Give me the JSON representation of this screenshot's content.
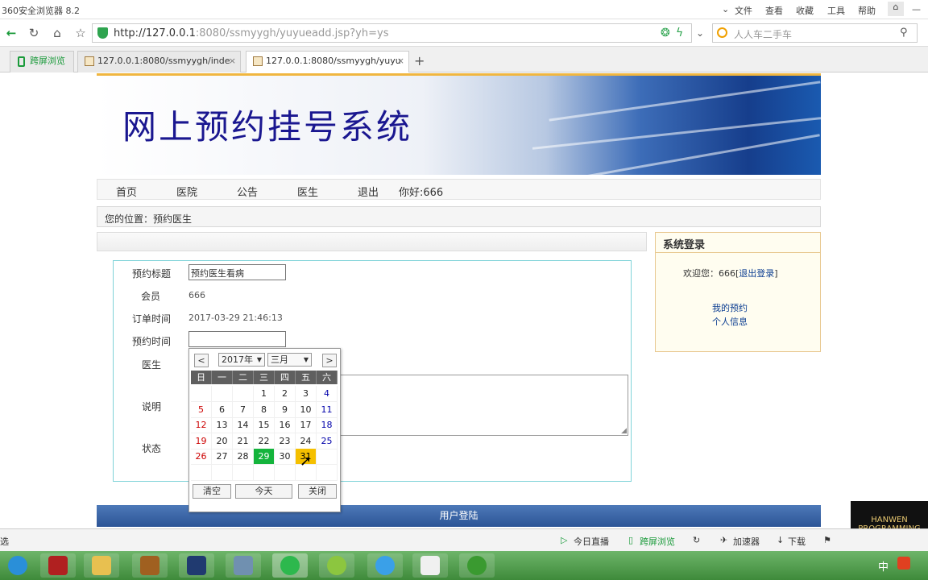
{
  "browser": {
    "app_title": "360安全浏览器 8.2",
    "menu": [
      "文件",
      "查看",
      "收藏",
      "工具",
      "帮助"
    ],
    "url_host": "http://127.0.0.1",
    "url_rest": ":8080/ssmyygh/yuyueadd.jsp?yh=ys",
    "search_text": "人人车二手车",
    "tabs": [
      "跨屏浏览",
      "127.0.0.1:8080/ssmyygh/inde",
      "127.0.0.1:8080/ssmyygh/yuyu"
    ]
  },
  "site": {
    "title": "网上预约挂号系统",
    "nav": [
      "首页",
      "医院",
      "公告",
      "医生",
      "退出",
      "你好:666"
    ],
    "breadcrumb": "您的位置：预约医生"
  },
  "form": {
    "labels": [
      "预约标题",
      "会员",
      "订单时间",
      "预约时间",
      "医生",
      "说明",
      "状态"
    ],
    "title_value": "预约医生看病",
    "member_value": "666",
    "order_time_value": "2017-03-29 21:46:13",
    "reserve_time_value": ""
  },
  "calendar": {
    "prev": "<",
    "next": ">",
    "year": "2017年",
    "month": "三月",
    "weekdays": [
      "日",
      "一",
      "二",
      "三",
      "四",
      "五",
      "六"
    ],
    "weeks": [
      [
        "",
        "",
        "",
        "1",
        "2",
        "3",
        "4"
      ],
      [
        "5",
        "6",
        "7",
        "8",
        "9",
        "10",
        "11"
      ],
      [
        "12",
        "13",
        "14",
        "15",
        "16",
        "17",
        "18"
      ],
      [
        "19",
        "20",
        "21",
        "22",
        "23",
        "24",
        "25"
      ],
      [
        "26",
        "27",
        "28",
        "29",
        "30",
        "31",
        ""
      ],
      [
        "",
        "",
        "",
        "",
        "",
        "",
        ""
      ]
    ],
    "today": "29",
    "hover": "31",
    "clear": "清空",
    "today_btn": "今天",
    "close": "关闭"
  },
  "sidebar": {
    "heading": "系统登录",
    "welcome": "欢迎您：666",
    "logout": "退出登录",
    "links": [
      "我的预约",
      "个人信息"
    ]
  },
  "footer_bar": "用户登陆",
  "statusbar": {
    "left": "选",
    "items": [
      "今日直播",
      "跨屏浏览",
      "加速器",
      "下载"
    ]
  },
  "watermark": "HANWEN PROGRAMMING",
  "tray": {
    "ime": "中"
  }
}
